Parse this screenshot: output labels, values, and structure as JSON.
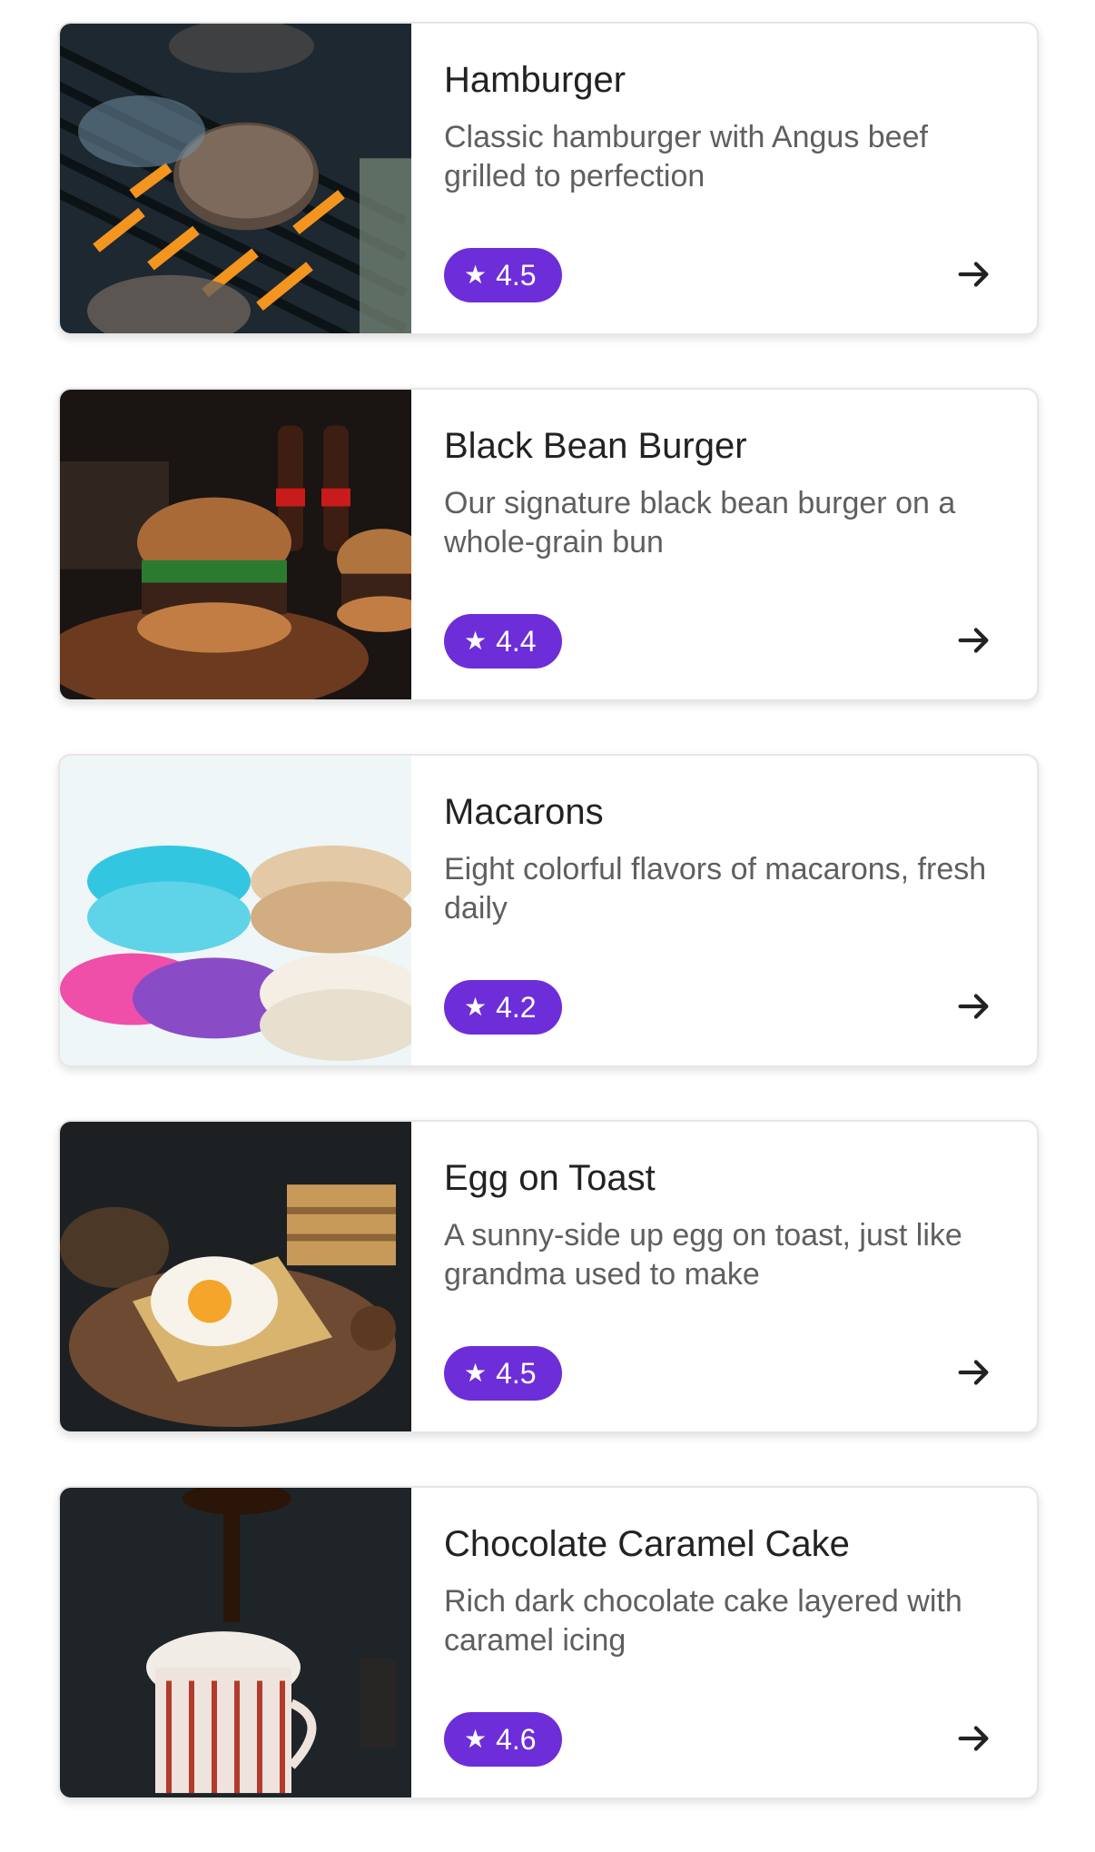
{
  "items": [
    {
      "title": "Hamburger",
      "description": "Classic hamburger with Angus beef grilled to perfection",
      "rating": "4.5",
      "image_subject": "grilled-burger-patties-photo"
    },
    {
      "title": "Black Bean Burger",
      "description": "Our signature black bean burger on a whole-grain bun",
      "rating": "4.4",
      "image_subject": "burgers-with-soda-bottles-photo"
    },
    {
      "title": "Macarons",
      "description": "Eight colorful flavors of macarons, fresh daily",
      "rating": "4.2",
      "image_subject": "stack-of-macarons-photo"
    },
    {
      "title": "Egg on Toast",
      "description": "A sunny-side up egg on toast, just like grandma used to make",
      "rating": "4.5",
      "image_subject": "fried-egg-on-toast-photo"
    },
    {
      "title": "Chocolate Caramel Cake",
      "description": "Rich dark chocolate cake layered with caramel icing",
      "rating": "4.6",
      "image_subject": "chocolate-drizzle-cup-photo"
    }
  ],
  "icons": {
    "star": "star-icon",
    "arrow": "arrow-right-icon"
  },
  "colors": {
    "accent": "#6d2ed9",
    "title": "#222222",
    "description": "#5f5f5f"
  }
}
